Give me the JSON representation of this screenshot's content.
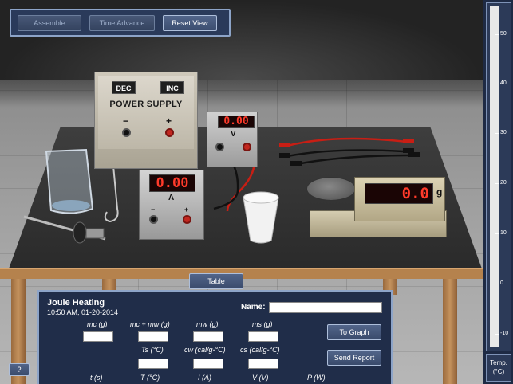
{
  "toolbar": {
    "assemble_label": "Assemble",
    "time_advance_label": "Time Advance",
    "reset_view_label": "Reset View"
  },
  "power_supply": {
    "dec_label": "DEC",
    "inc_label": "INC",
    "title": "POWER SUPPLY",
    "minus_label": "−",
    "plus_label": "+"
  },
  "voltmeter": {
    "reading": "0.00",
    "unit": "V"
  },
  "ammeter": {
    "reading": "0.00",
    "unit": "A",
    "minus_label": "−",
    "plus_label": "+"
  },
  "scale": {
    "reading": "0.0",
    "unit": "g"
  },
  "thermometer": {
    "ticks": [
      "50",
      "40",
      "30",
      "20",
      "10",
      "0",
      "-10"
    ],
    "label_line1": "Temp.",
    "label_line2": "(°C)"
  },
  "table_tab_label": "Table",
  "panel": {
    "title": "Joule Heating",
    "timestamp": "10:50 AM, 01-20-2014",
    "name_label": "Name:",
    "fields": {
      "mc": "mc (g)",
      "mcw": "mc + mw (g)",
      "mw": "mw (g)",
      "ms": "ms (g)",
      "ts": "Ts (°C)",
      "cw": "cw (cal/g-°C)",
      "cs": "cs (cal/g-°C)"
    },
    "to_graph_label": "To Graph",
    "send_report_label": "Send Report",
    "columns": [
      "t (s)",
      "T (°C)",
      "I (A)",
      "V (V)",
      "P (W)"
    ]
  },
  "help_label": "?"
}
